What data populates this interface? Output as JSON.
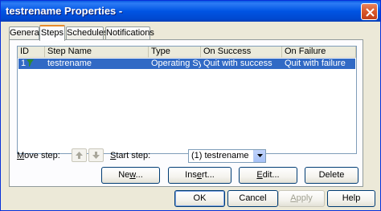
{
  "window": {
    "title": "testrename Properties -"
  },
  "tabs": [
    {
      "label": "General"
    },
    {
      "label": "Steps"
    },
    {
      "label": "Schedules"
    },
    {
      "label": "Notifications"
    }
  ],
  "steps_list": {
    "columns": [
      "ID",
      "Step Name",
      "Type",
      "On Success",
      "On Failure"
    ],
    "rows": [
      {
        "id": "1",
        "name": "testrename",
        "type": "Operating Sy...",
        "on_success": "Quit with success",
        "on_failure": "Quit with failure",
        "selected": true
      }
    ]
  },
  "move_step": {
    "label_underlined": "M",
    "label_rest": "ove step:"
  },
  "start_step": {
    "label_underlined": "S",
    "label_rest": "tart step:",
    "value": "(1) testrename"
  },
  "step_buttons": {
    "new": {
      "before": "Ne",
      "u": "w",
      "after": "..."
    },
    "insert": {
      "before": "Ins",
      "u": "e",
      "after": "rt..."
    },
    "edit": {
      "before": "",
      "u": "E",
      "after": "dit..."
    },
    "delete": {
      "label": "Delete"
    }
  },
  "dialog_buttons": {
    "ok": "OK",
    "cancel": "Cancel",
    "apply": {
      "u": "A",
      "rest": "pply"
    },
    "help": "Help"
  },
  "colors": {
    "selection": "#316ac5",
    "titlebar": "#0054e3",
    "flag": "#2e8b2e"
  }
}
